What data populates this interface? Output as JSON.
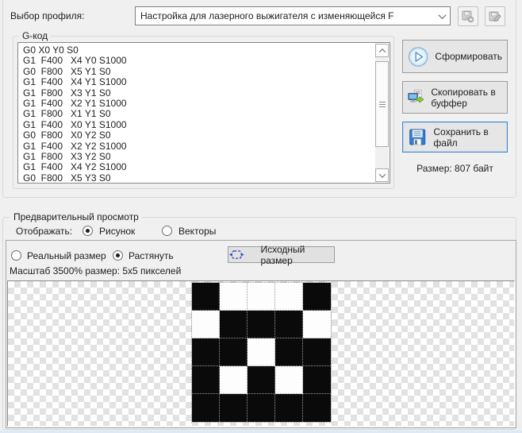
{
  "profile": {
    "label": "Выбор профиля:",
    "selected": "Настройка для лазерного выжигателя с изменяющейся F"
  },
  "gcode": {
    "group_title": "G-код",
    "lines": [
      "G0 X0 Y0 S0",
      "G1  F400   X4 Y0 S1000",
      "G0  F800   X5 Y1 S0",
      "G1  F400   X4 Y1 S1000",
      "G1  F800   X3 Y1 S0",
      "G1  F400   X2 Y1 S1000",
      "G1  F800   X1 Y1 S0",
      "G1  F400   X0 Y1 S1000",
      "G0  F800   X0 Y2 S0",
      "G1  F400   X2 Y2 S1000",
      "G1  F800   X3 Y2 S0",
      "G1  F400   X4 Y2 S1000",
      "G0  F800   X5 Y3 S0"
    ]
  },
  "actions": {
    "generate_label": "Сформировать",
    "copy_label": "Скопировать в буффер",
    "save_label": "Сохранить в файл",
    "size_text": "Размер: 807 байт"
  },
  "preview": {
    "group_title": "Предварительный просмотр",
    "display_label": "Отображать:",
    "display_options": [
      {
        "label": "Рисунок",
        "selected": true
      },
      {
        "label": "Векторы",
        "selected": false
      }
    ],
    "size_mode_options": [
      {
        "label": "Реальный размер",
        "selected": false
      },
      {
        "label": "Растянуть",
        "selected": true
      }
    ],
    "original_size_label": "Исходный размер",
    "scale_text": "Масштаб 3500% размер: 5x5 пикселей",
    "image_pixels": {
      "width": 5,
      "height": 5,
      "rows": [
        [
          1,
          0,
          0,
          0,
          1
        ],
        [
          0,
          1,
          1,
          1,
          0
        ],
        [
          1,
          1,
          0,
          1,
          1
        ],
        [
          1,
          0,
          1,
          0,
          1
        ],
        [
          1,
          1,
          1,
          1,
          1
        ]
      ]
    }
  },
  "icons": {
    "profile_save": "floppy-plus-icon",
    "profile_edit": "floppy-edit-icon",
    "generate": "play-icon",
    "copy": "copy-to-clipboard-icon",
    "save": "floppy-icon",
    "original_size": "fit-selection-icon"
  },
  "colors": {
    "window_bg": "#f0f0f0",
    "focus_border": "#4a86c8",
    "floppy_blue": "#2f7cd3",
    "arrow_green": "#8dc63f",
    "fit_icon_blue": "#3752c8",
    "pixel_black": "#0a0a0a",
    "pixel_white": "#fdfdfd"
  }
}
